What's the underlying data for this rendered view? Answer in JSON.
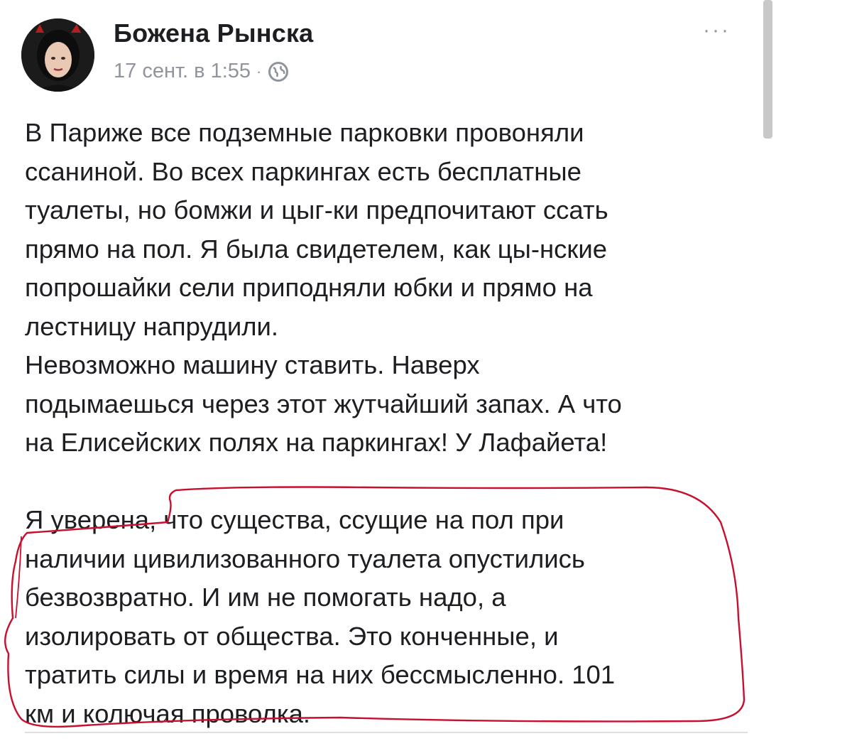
{
  "post": {
    "author": "Божена Рынска",
    "timestamp": "17 сент. в 1:55",
    "separator": "·",
    "privacy_icon": "globe-icon",
    "more_icon": "more-dots-icon",
    "more_label": "···",
    "paragraph_1": "В Париже все подземные парковки провоняли\nссаниной. Во всех паркингах есть бесплатные\nтуалеты, но бомжи и цыг-ки предпочитают ссать\nпрямо на пол. Я была свидетелем, как цы-нские\nпопрошайки сели приподняли юбки  и прямо на\nлестницу напрудили.\nНевозможно машину ставить. Наверх\nподымаешься через этот жутчайший запах. А что\nна Елисейских полях на паркингах! У Лафайета!",
    "paragraph_2": "Я уверена, что существа, ссущие на пол при\nналичии цивилизованного туалета опустились\nбезвозвратно. И им не помогать надо, а\nизолировать от общества. Это конченные, и\nтратить силы и время на них бессмысленно. 101\nкм и колючая проволка."
  },
  "colors": {
    "text": "#1c1e21",
    "meta": "#90949c",
    "annotation": "#c8102e"
  }
}
